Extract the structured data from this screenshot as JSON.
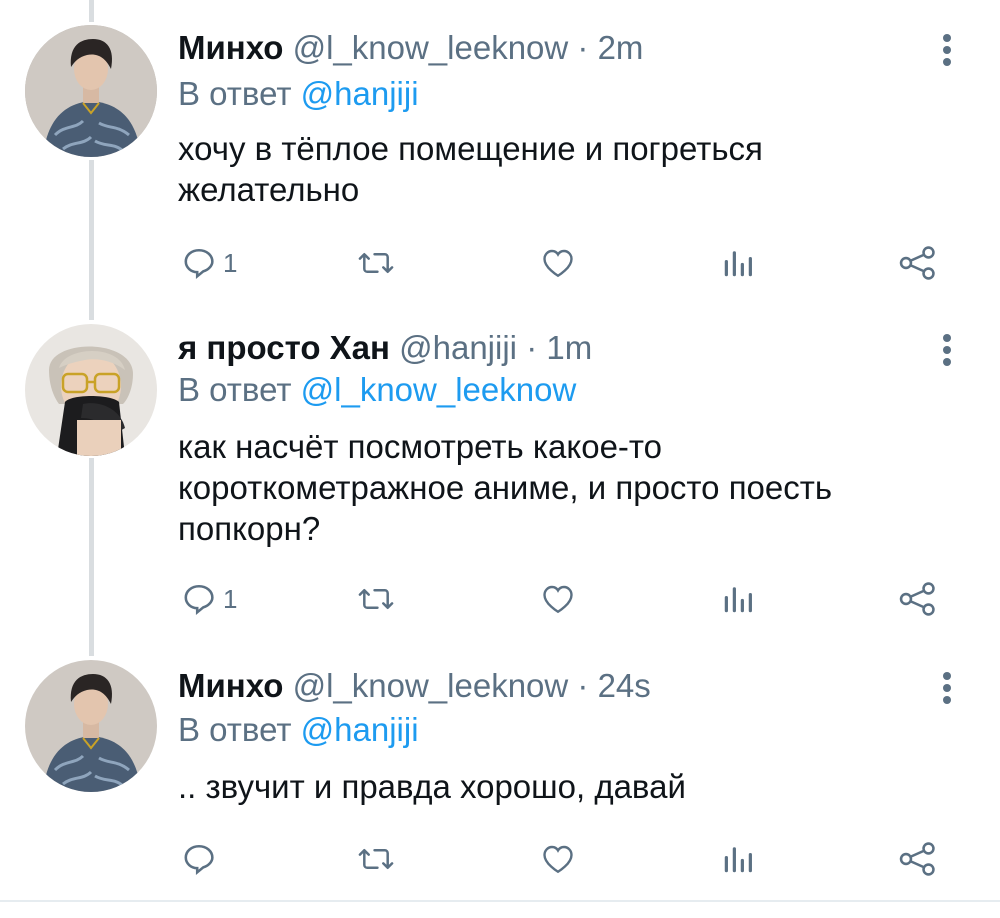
{
  "colors": {
    "accent": "#1d9bf0",
    "secondary_text": "#5b7083",
    "primary_text": "#0f1419",
    "thread_line": "#d9dde0"
  },
  "reply_prefix": "В ответ",
  "tweets": [
    {
      "name": "Минхо",
      "handle": "@l_know_leeknow",
      "separator": "·",
      "time": "2m",
      "reply_to": "@hanjiji",
      "text": "хочу в тёплое помещение и погреться желательно",
      "reply_count": "1",
      "avatar_icon": "avatar-minho"
    },
    {
      "name": "я просто Хан",
      "handle": "@hanjiji",
      "separator": "·",
      "time": "1m",
      "reply_to": "@l_know_leeknow",
      "text": "как насчёт посмотреть какое-то короткометражное аниме, и просто поесть попкорн?",
      "reply_count": "1",
      "avatar_icon": "avatar-han"
    },
    {
      "name": "Минхо",
      "handle": "@l_know_leeknow",
      "separator": "·",
      "time": "24s",
      "reply_to": "@hanjiji",
      "text": ".. звучит и правда хорошо, давай",
      "reply_count": "",
      "avatar_icon": "avatar-minho"
    }
  ],
  "action_icons": [
    "reply-icon",
    "retweet-icon",
    "like-icon",
    "analytics-icon",
    "share-icon"
  ]
}
